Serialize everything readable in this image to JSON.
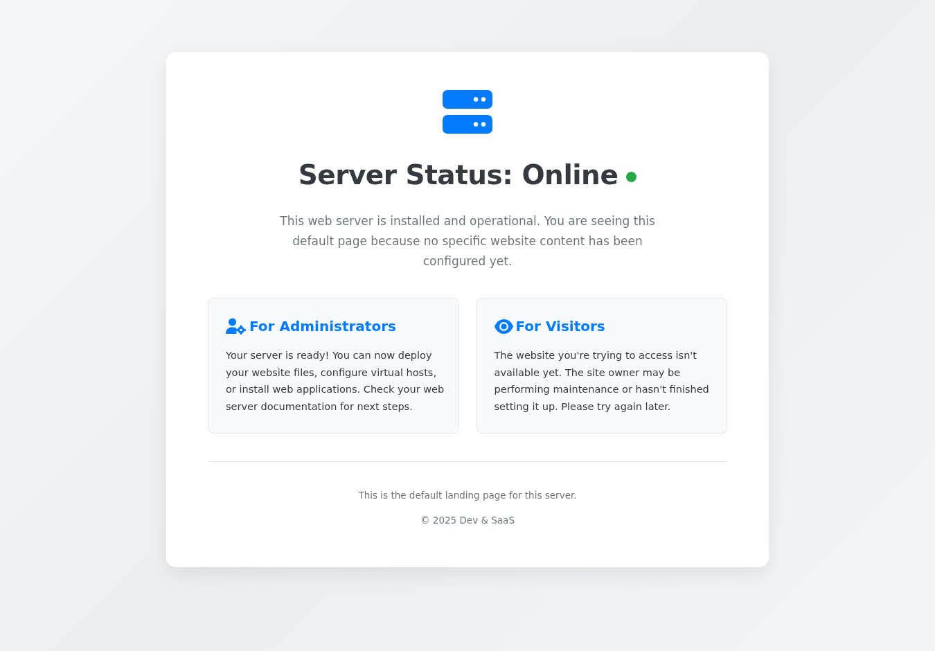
{
  "title": "Server Status: Online",
  "description": "This web server is installed and operational. You are seeing this default page because no specific website content has been configured yet.",
  "cards": [
    {
      "kind": "admin",
      "title": "For Administrators",
      "text": "Your server is ready! You can now deploy your website files, configure virtual hosts, or install web applications. Check your web server documentation for next steps."
    },
    {
      "kind": "visitor",
      "title": "For Visitors",
      "text": "The website you're trying to access isn't available yet. The site owner may be performing maintenance or hasn't finished setting it up. Please try again later."
    }
  ],
  "footer": [
    "This is the default landing page for this server.",
    "© 2025 Dev & SaaS"
  ]
}
